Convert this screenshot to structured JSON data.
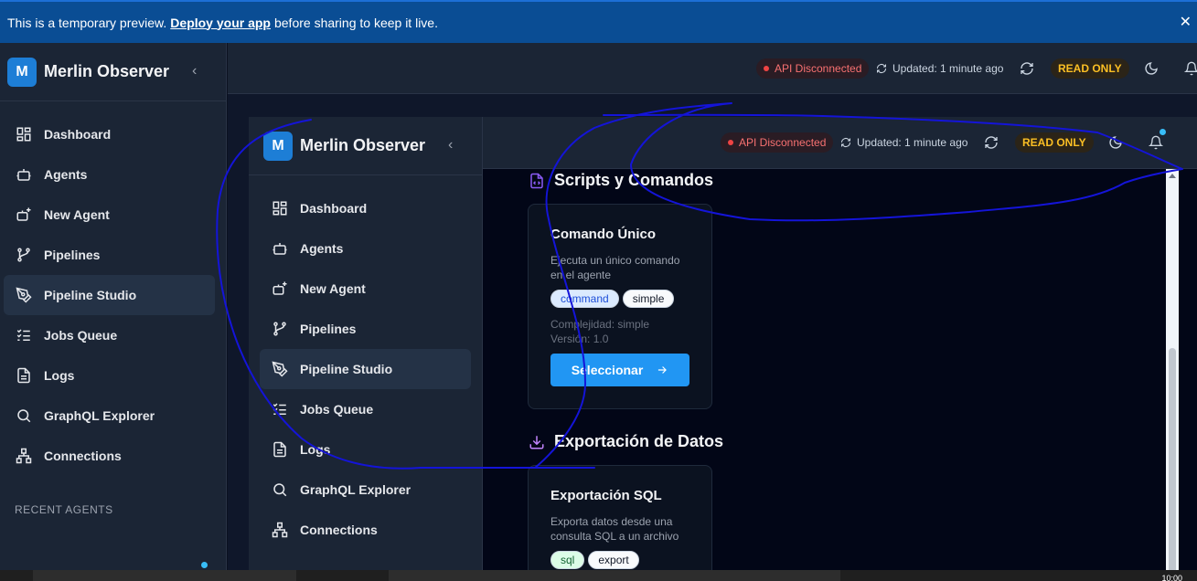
{
  "banner": {
    "text_before": "This is a temporary preview.",
    "link": "Deploy your app",
    "text_after": "before sharing to keep it live.",
    "close": "✕"
  },
  "app": {
    "logo_letter": "M",
    "name": "Merlin Observer",
    "collapse": "‹"
  },
  "nav": [
    {
      "label": "Dashboard",
      "icon": "dashboard-icon"
    },
    {
      "label": "Agents",
      "icon": "bot-icon"
    },
    {
      "label": "New Agent",
      "icon": "bot-plus-icon"
    },
    {
      "label": "Pipelines",
      "icon": "git-branch-icon"
    },
    {
      "label": "Pipeline Studio",
      "icon": "pen-tool-icon"
    },
    {
      "label": "Jobs Queue",
      "icon": "list-checks-icon"
    },
    {
      "label": "Logs",
      "icon": "file-text-icon"
    },
    {
      "label": "GraphQL Explorer",
      "icon": "search-icon"
    },
    {
      "label": "Connections",
      "icon": "network-icon"
    }
  ],
  "recent_agents_label": "RECENT AGENTS",
  "topbar": {
    "api_status": "API Disconnected",
    "updated": "Updated: 1 minute ago",
    "read_only": "READ ONLY"
  },
  "sections": [
    {
      "title": "Scripts y Comandos",
      "icon": "file-code-icon",
      "cards": [
        {
          "title": "Comando Único",
          "description": "Ejecuta un único comando en el agente",
          "tags": [
            "command",
            "simple"
          ],
          "complexity": "Complejidad: simple",
          "version": "Versión: 1.0",
          "button": "Seleccionar"
        }
      ]
    },
    {
      "title": "Exportación de Datos",
      "icon": "download-icon",
      "cards": [
        {
          "title": "Exportación SQL",
          "description": "Exporta datos desde una consulta SQL a un archivo",
          "tags": [
            "sql",
            "export"
          ]
        }
      ]
    }
  ],
  "taskbar": {
    "clock": "10:00"
  },
  "colors": {
    "accent": "#2196f3",
    "logo": "#1d7ed6",
    "disconnected": "#ef4444",
    "read_only": "#fbbf24",
    "annotation": "#1414d8"
  }
}
